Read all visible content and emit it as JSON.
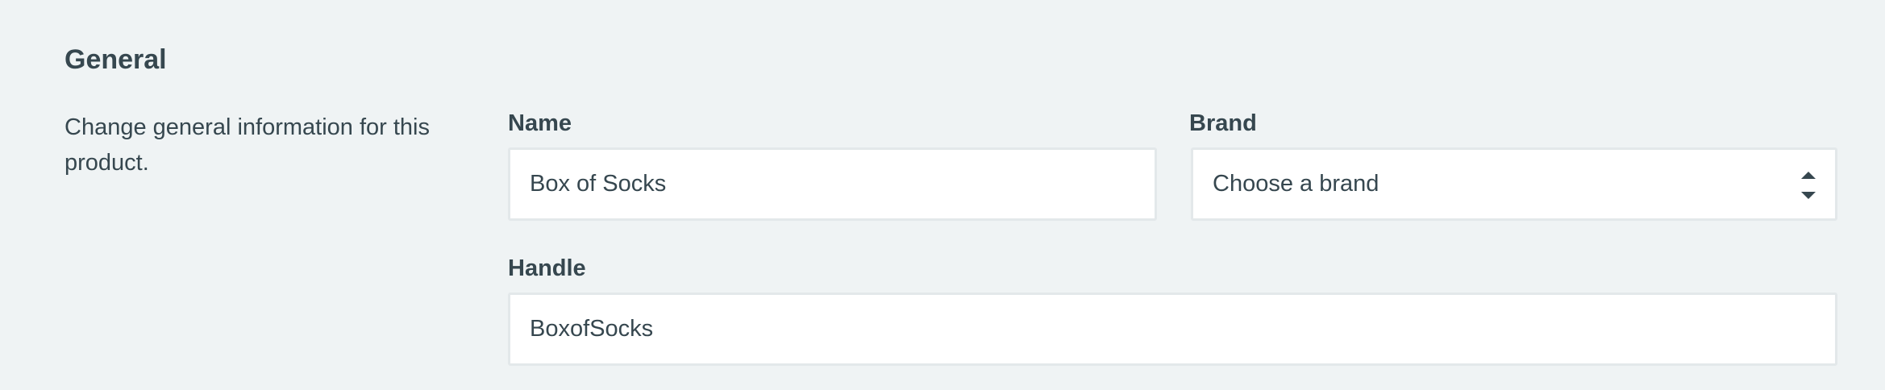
{
  "section": {
    "title": "General",
    "description": "Change general information for this product."
  },
  "fields": {
    "name": {
      "label": "Name",
      "value": "Box of Socks"
    },
    "brand": {
      "label": "Brand",
      "selected": "Choose a brand",
      "icon": "up-down-arrows-icon"
    },
    "handle": {
      "label": "Handle",
      "value": "BoxofSocks"
    }
  },
  "colors": {
    "background": "#eff3f4",
    "text": "#36474f",
    "input_border": "#e3e8ea",
    "input_background": "#ffffff"
  }
}
